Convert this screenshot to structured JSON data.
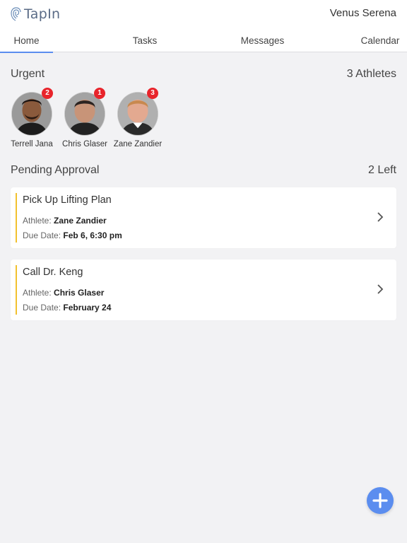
{
  "app": {
    "logo_text": "TapIn",
    "user_name": "Venus Serena"
  },
  "tabs": [
    {
      "label": "Home",
      "active": true
    },
    {
      "label": "Tasks",
      "active": false
    },
    {
      "label": "Messages",
      "active": false
    },
    {
      "label": "Calendar",
      "active": false
    }
  ],
  "urgent": {
    "title": "Urgent",
    "count_label": "3 Athletes",
    "athletes": [
      {
        "name": "Terrell Jana",
        "badge": "2"
      },
      {
        "name": "Chris Glaser",
        "badge": "1"
      },
      {
        "name": "Zane Zandier",
        "badge": "3"
      }
    ]
  },
  "pending": {
    "title": "Pending Approval",
    "count_label": "2 Left",
    "items": [
      {
        "title": "Pick Up Lifting Plan",
        "athlete_label": "Athlete:",
        "athlete": "Zane Zandier",
        "due_label": "Due Date:",
        "due": "Feb 6, 6:30 pm"
      },
      {
        "title": "Call Dr. Keng",
        "athlete_label": "Athlete:",
        "athlete": "Chris Glaser",
        "due_label": "Due Date:",
        "due": "February 24"
      }
    ]
  },
  "colors": {
    "accent": "#5b8def",
    "card_accent": "#f2c12e",
    "badge": "#e8242b"
  },
  "icons": {
    "logo": "fingerprint-icon",
    "chevron": "chevron-right-icon",
    "fab": "plus-icon"
  }
}
